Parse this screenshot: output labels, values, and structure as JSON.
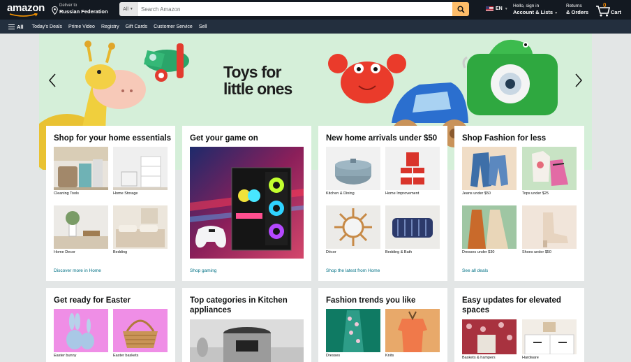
{
  "header": {
    "logo": "amazon",
    "deliver_line1": "Deliver to",
    "deliver_line2": "Russian Federation",
    "search_category": "All",
    "search_placeholder": "Search Amazon",
    "language": "EN",
    "account_line1": "Hello, sign in",
    "account_line2": "Account & Lists",
    "returns_line1": "Returns",
    "returns_line2": "& Orders",
    "cart_count": "0",
    "cart_label": "Cart"
  },
  "subnav": {
    "all_label": "All",
    "links": [
      "Today's Deals",
      "Prime Video",
      "Registry",
      "Gift Cards",
      "Customer Service",
      "Sell"
    ]
  },
  "hero": {
    "title_line1": "Toys for",
    "title_line2": "little ones"
  },
  "cards": [
    {
      "title": "Shop for your home essentials",
      "tiles": [
        "Cleaning Tools",
        "Home Storage",
        "Home Decor",
        "Bedding"
      ],
      "link": "Discover more in Home"
    },
    {
      "title": "Get your game on",
      "link": "Shop gaming"
    },
    {
      "title": "New home arrivals under $50",
      "tiles": [
        "Kitchen & Dining",
        "Home Improvement",
        "Décor",
        "Bedding & Bath"
      ],
      "link": "Shop the latest from Home"
    },
    {
      "title": "Shop Fashion for less",
      "tiles": [
        "Jeans under $50",
        "Tops under $25",
        "Dresses under $30",
        "Shoes under $50"
      ],
      "link": "See all deals"
    },
    {
      "title": "Get ready for Easter",
      "tiles": [
        "Easter bunny",
        "Easter baskets"
      ]
    },
    {
      "title_line1": "Top categories in Kitchen",
      "title_line2": "appliances"
    },
    {
      "title": "Fashion trends you like",
      "tiles": [
        "Dresses",
        "Knits"
      ]
    },
    {
      "title_line1": "Easy updates for elevated",
      "title_line2": "spaces",
      "tiles": [
        "Baskets & hampers",
        "Hardware"
      ]
    }
  ],
  "colors": {
    "nav_top": "#131921",
    "nav_sub": "#232f3e",
    "search_button": "#febd69",
    "link": "#007185",
    "hero_bg": "#d5efd9",
    "page_bg": "#e3e6e6"
  }
}
